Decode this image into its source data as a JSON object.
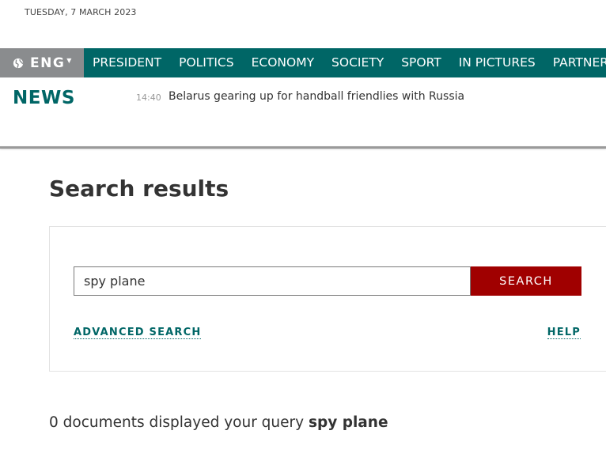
{
  "header": {
    "date": "TUESDAY, 7 MARCH 2023"
  },
  "nav": {
    "language": "ENG",
    "language_icon": "globe-icon",
    "items": [
      "PRESIDENT",
      "POLITICS",
      "ECONOMY",
      "SOCIETY",
      "SPORT",
      "IN PICTURES",
      "PARTNERS"
    ],
    "background_color": "#006666",
    "language_background_color": "#8a8c8e"
  },
  "ticker": {
    "label": "NEWS",
    "time": "14:40",
    "headline": "Belarus gearing up for handball friendlies with Russia"
  },
  "main": {
    "title": "Search results",
    "search": {
      "value": "spy plane",
      "button_label": "SEARCH",
      "button_color": "#a00000",
      "advanced_link": "ADVANCED SEARCH",
      "help_link": "HELP"
    },
    "results": {
      "prefix": "0 documents displayed your query ",
      "query": "spy plane"
    }
  }
}
